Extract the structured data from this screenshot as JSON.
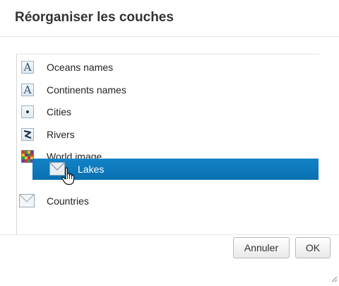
{
  "dialog": {
    "title": "Réorganiser les couches"
  },
  "layers": [
    {
      "label": "Oceans names",
      "icon": "text-symbol-icon",
      "glyph": "A"
    },
    {
      "label": "Continents names",
      "icon": "text-symbol-icon",
      "glyph": "A"
    },
    {
      "label": "Cities",
      "icon": "point-symbol-icon"
    },
    {
      "label": "Rivers",
      "icon": "line-symbol-icon"
    },
    {
      "label": "World image",
      "icon": "raster-symbol-icon"
    },
    {
      "label": "Countries",
      "icon": "polygon-symbol-icon"
    }
  ],
  "dragging": {
    "label": "Lakes",
    "icon": "polygon-symbol-icon",
    "highlight_color": "#0a7cc0"
  },
  "buttons": {
    "cancel": "Annuler",
    "ok": "OK"
  },
  "cursor": "hand-pointer-icon"
}
